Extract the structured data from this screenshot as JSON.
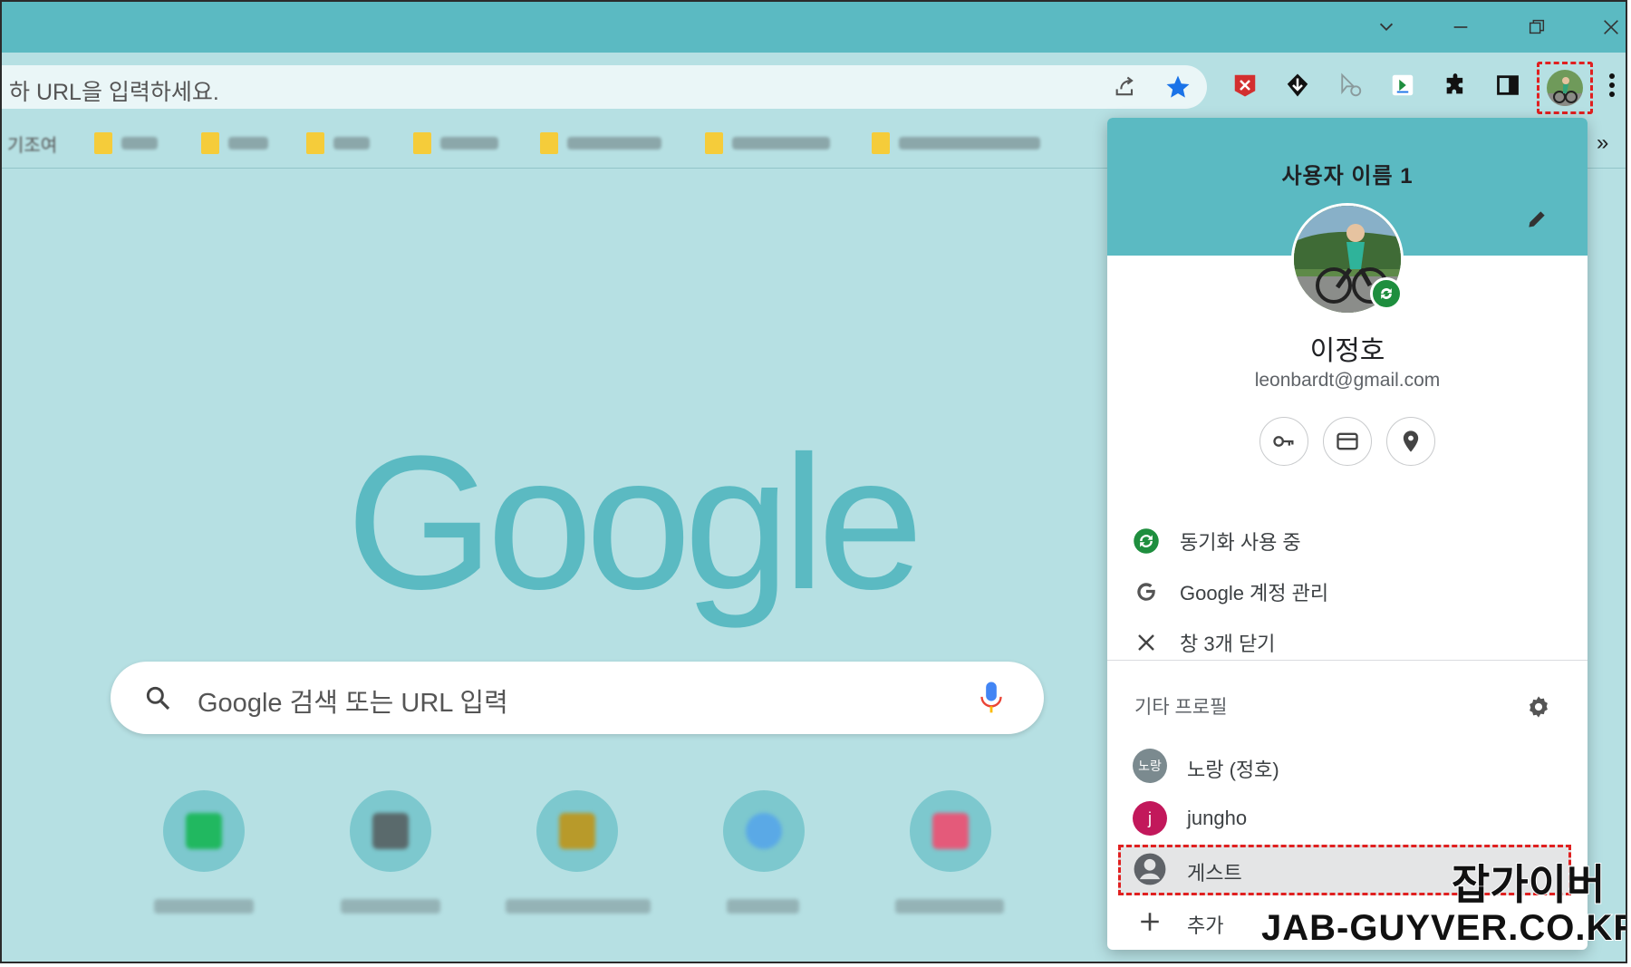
{
  "window": {
    "controls": [
      "chevron-down-icon",
      "minimize-icon",
      "restore-icon",
      "close-icon"
    ]
  },
  "toolbar": {
    "omnibox_text": "하 URL을 입력하세요.",
    "icons": [
      "share-icon",
      "star-icon",
      "extension-red-icon",
      "extension-black-icon",
      "extension-cursor-icon",
      "extension-app-icon",
      "puzzle-icon",
      "side-panel-icon",
      "profile-avatar",
      "more-vert-icon"
    ],
    "accent": "#1a73e8"
  },
  "bookmarks": {
    "first_label_fragment": "기조여",
    "overflow": "»"
  },
  "newtab": {
    "logo": "Google",
    "search_placeholder": "Google 검색 또는 URL 입력"
  },
  "profile_popup": {
    "profile_name": "사용자 이름 1",
    "account_name": "이정호",
    "account_email": "leonbardt@gmail.com",
    "quick_buttons": [
      "key-icon",
      "card-icon",
      "location-icon"
    ],
    "menu": [
      {
        "label": "동기화 사용 중",
        "icon": "sync-icon"
      },
      {
        "label": "Google 계정 관리",
        "icon": "google-g-icon"
      },
      {
        "label": "창 3개 닫기",
        "icon": "close-icon"
      }
    ],
    "other_profiles_title": "기타 프로필",
    "profiles": [
      {
        "label": "노랑 (정호)",
        "avatar_text": "노랑",
        "color": "#7b8a8f"
      },
      {
        "label": "jungho",
        "avatar_text": "j",
        "color": "#c2185b"
      },
      {
        "label": "게스트",
        "avatar_text": "",
        "color": "#5f6368"
      }
    ],
    "add_label": "추가",
    "header_color": "#5bbac2",
    "sync_color": "#1e8e3e"
  },
  "watermark": {
    "line1": "잡가이버",
    "line2": "JAB-GUYVER.CO.KR"
  }
}
